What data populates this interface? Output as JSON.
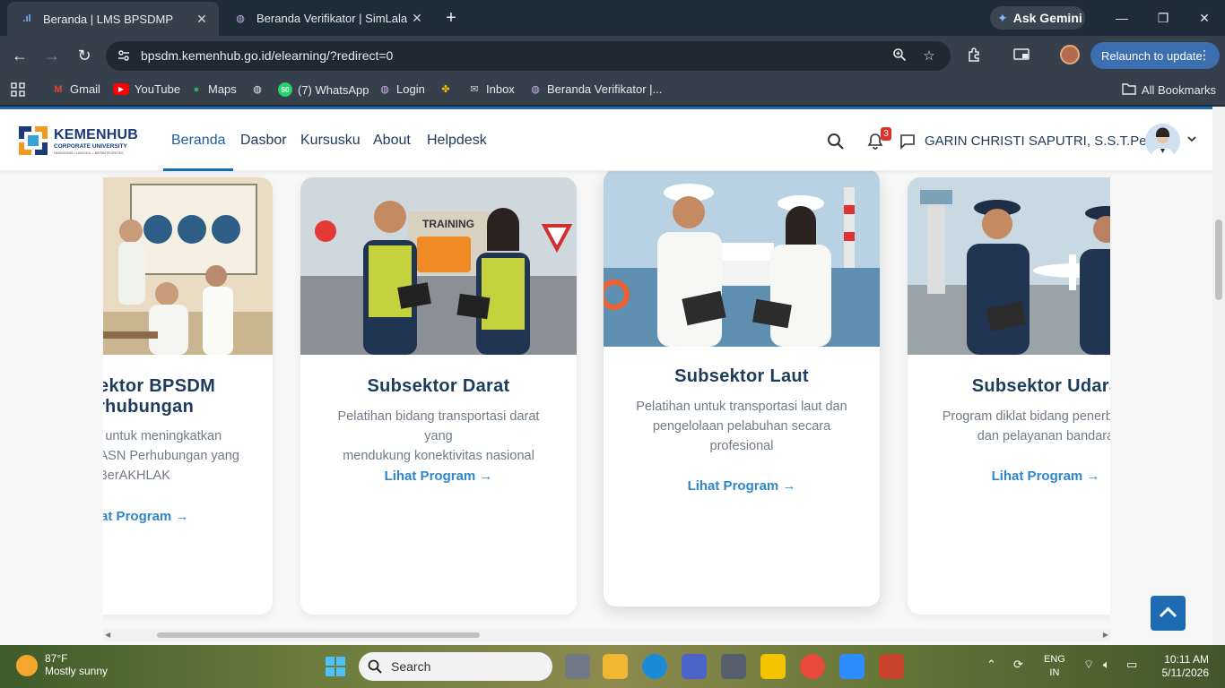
{
  "browser": {
    "tabs": [
      {
        "title": "Beranda | LMS BPSDMP",
        "active": true
      },
      {
        "title": "Beranda Verifikator | SimLala",
        "active": false
      }
    ],
    "gemini_label": "Ask Gemini",
    "url": "bpsdm.kemenhub.go.id/elearning/?redirect=0",
    "relaunch_label": "Relaunch to update",
    "bookmarks": [
      "Gmail",
      "YouTube",
      "Maps",
      "(7) WhatsApp",
      "Login",
      "Inbox",
      "Beranda Verifikator |..."
    ],
    "whatsapp_badge": "50",
    "all_bookmarks": "All Bookmarks"
  },
  "site": {
    "logo_name": "KEMENHUB",
    "logo_sub": "CORPORATE UNIVERSITY",
    "logo_tag": "HARMONIS • UNGGUL • BERINTEGRITAS",
    "menu": [
      "Beranda",
      "Dasbor",
      "Kursusku",
      "About",
      "Helpdesk"
    ],
    "notification_count": "3",
    "user_name": "GARIN CHRISTI SAPUTRI, S.S.T.Pel"
  },
  "cards": [
    {
      "title_line1": "Subsektor BPSDM",
      "title_line2": "Perhubungan",
      "desc_lines": [
        "Pelatihan untuk meningkatkan",
        "kompetensi ASN Perhubungan yang",
        "BerAKHLAK"
      ],
      "link": "Lihat Program →"
    },
    {
      "title_line1": "Subsektor Darat",
      "desc_lines": [
        "Pelatihan bidang transportasi darat yang",
        "mendukung konektivitas nasional"
      ],
      "link": "Lihat Program →",
      "image_sign": "TRAINING"
    },
    {
      "title_line1": "Subsektor Laut",
      "desc_lines": [
        "Pelatihan untuk transportasi laut dan",
        "pengelolaan pelabuhan secara",
        "profesional"
      ],
      "link": "Lihat Program →"
    },
    {
      "title_line1": "Subsektor Udara",
      "desc_lines": [
        "Program diklat bidang penerbangan",
        "dan pelayanan bandara"
      ],
      "link": "Lihat Program →"
    }
  ],
  "taskbar": {
    "weather_temp": "87°F",
    "weather_desc": "Mostly sunny",
    "search_label": "Search",
    "lang1": "ENG",
    "lang2": "IN",
    "time": "10:11 AM",
    "date": "5/11/2026"
  },
  "colors": {
    "accent": "#1c6bb3",
    "link": "#2f86c9",
    "title": "#1d3b5a"
  }
}
